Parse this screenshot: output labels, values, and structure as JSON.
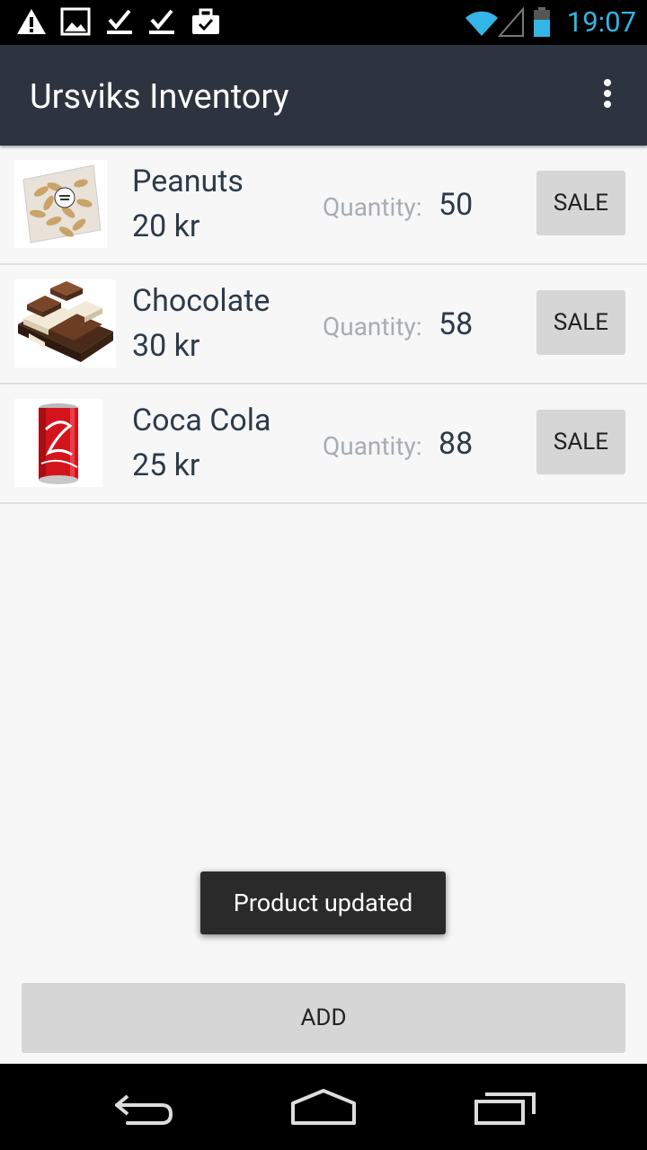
{
  "status_bar": {
    "time": "19:07",
    "icons": [
      "warning-icon",
      "image-icon",
      "download-done-icon",
      "download-done-icon",
      "briefcase-check-icon",
      "wifi-icon",
      "signal-icon",
      "battery-icon"
    ],
    "accent": "#33b5e5"
  },
  "action_bar": {
    "title": "Ursviks Inventory",
    "menu_icon": "overflow-menu-icon",
    "background": "#2d3440"
  },
  "products": [
    {
      "name": "Peanuts",
      "price": "20 kr",
      "quantity_label": "Quantity:",
      "quantity": "50",
      "sale_label": "SALE",
      "image": "peanuts-bag-image"
    },
    {
      "name": "Chocolate",
      "price": "30 kr",
      "quantity_label": "Quantity:",
      "quantity": "58",
      "sale_label": "SALE",
      "image": "chocolate-stack-image"
    },
    {
      "name": "Coca Cola",
      "price": "25 kr",
      "quantity_label": "Quantity:",
      "quantity": "88",
      "sale_label": "SALE",
      "image": "coca-cola-can-image"
    }
  ],
  "toast": {
    "message": "Product updated"
  },
  "add_button": {
    "label": "ADD"
  },
  "nav_bar": {
    "icons": [
      "back-icon",
      "home-icon",
      "recent-apps-icon"
    ]
  }
}
